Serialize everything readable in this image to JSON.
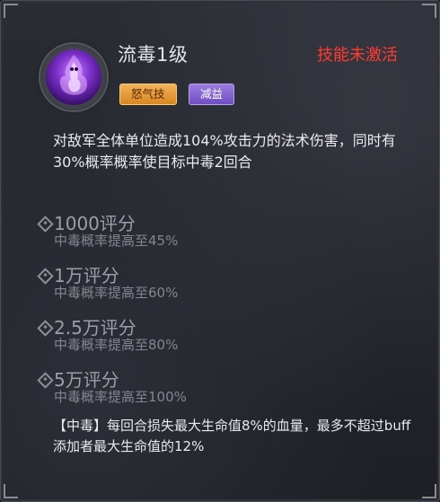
{
  "skill": {
    "name": "流毒1级",
    "status": "技能未激活",
    "icon": "poison-flame-icon",
    "tags": [
      "怒气技",
      "减益"
    ],
    "description": "对敌军全体单位造成104%攻击力的法术伤害，同时有30%概率概率使目标中毒2回合"
  },
  "upgrades": [
    {
      "score": "1000评分",
      "effect": "中毒概率提高至45%"
    },
    {
      "score": "1万评分",
      "effect": "中毒概率提高至60%"
    },
    {
      "score": "2.5万评分",
      "effect": "中毒概率提高至80%"
    },
    {
      "score": "5万评分",
      "effect": "中毒概率提高至100%"
    }
  ],
  "note": "【中毒】每回合损失最大生命值8%的血量，最多不超过buff添加者最大生命值的12%",
  "colors": {
    "status": "#ff3b30",
    "tag_rage": "#e39a35",
    "tag_debuff": "#8a6ad6"
  }
}
